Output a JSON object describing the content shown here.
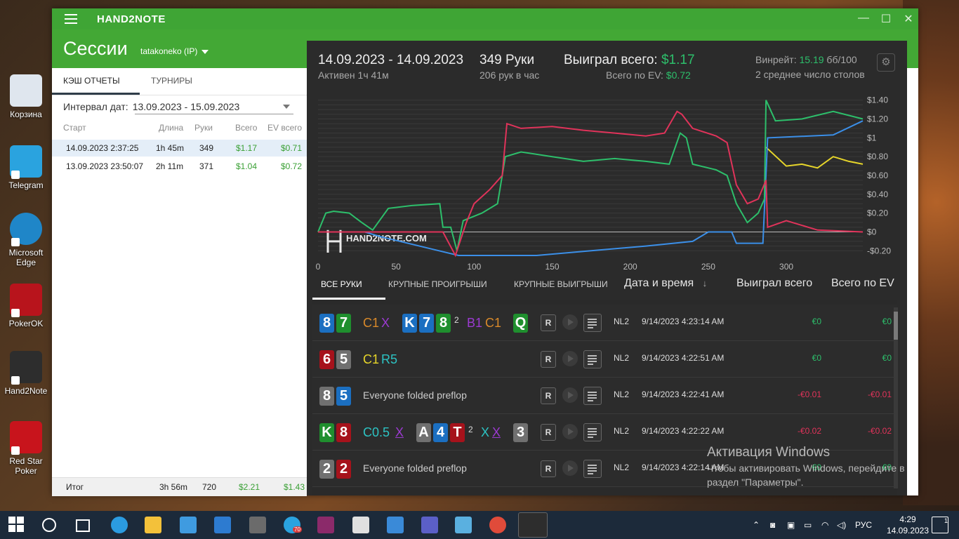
{
  "desktop_icons": [
    {
      "label": "Корзина",
      "icon": "recycle-bin-icon",
      "color": "#dfe6ee"
    },
    {
      "label": "Telegram",
      "icon": "telegram-icon",
      "color": "#2aa3df"
    },
    {
      "label": "Microsoft Edge",
      "icon": "edge-icon",
      "color": "#1f86c8"
    },
    {
      "label": "PokerOK",
      "icon": "pokerok-icon",
      "color": "#b8141c"
    },
    {
      "label": "Hand2Note",
      "icon": "hand2note-icon",
      "color": "#2d2d2d"
    },
    {
      "label": "Red Star Poker",
      "icon": "redstar-poker-icon",
      "color": "#c8141c"
    }
  ],
  "window": {
    "app_name": "HAND2NOTE",
    "controls": {
      "minimize": "—",
      "maximize": "☐",
      "close": "✕"
    }
  },
  "header": {
    "title": "Сессии",
    "user": "tatakoneko (IP)"
  },
  "left": {
    "tabs": [
      "КЭШ ОТЧЕТЫ",
      "ТУРНИРЫ"
    ],
    "interval_label": "Интервал дат:",
    "interval_value": "13.09.2023 - 15.09.2023",
    "columns": [
      "Старт",
      "Длина",
      "Руки",
      "Всего",
      "EV всего"
    ],
    "rows": [
      {
        "start": "14.09.2023 2:37:25",
        "length": "1h 45m",
        "hands": "349",
        "total": "$1.17",
        "ev": "$0.71"
      },
      {
        "start": "13.09.2023 23:50:07",
        "length": "2h 11m",
        "hands": "371",
        "total": "$1.04",
        "ev": "$0.72"
      }
    ],
    "footer": {
      "label": "Итог",
      "length": "3h 56m",
      "hands": "720",
      "total": "$2.21",
      "ev": "$1.43"
    }
  },
  "summary": {
    "date_range": "14.09.2023 - 14.09.2023",
    "active": "Активен 1ч 41м",
    "hands": "349 Руки",
    "hands_per_hour": "206 рук в час",
    "won_label": "Выиграл всего:",
    "won_value": "$1.17",
    "ev_label": "Всего по EV:",
    "ev_value": "$0.72",
    "winrate_label": "Винрейт:",
    "winrate_value": "15.19",
    "winrate_unit": "бб/100",
    "tables": "2 среднее число столов"
  },
  "chart_data": {
    "type": "line",
    "watermark": "HAND2NOTE.COM",
    "x_ticks": [
      0,
      50,
      100,
      150,
      200,
      250,
      300
    ],
    "y_ticks": [
      "$1.40",
      "$1.20",
      "$1",
      "$0.80",
      "$0.60",
      "$0.40",
      "$0.20",
      "$0",
      "-$0.20"
    ],
    "xlim": [
      0,
      349
    ],
    "ylim": [
      -0.25,
      1.45
    ],
    "series": [
      {
        "color": "#e0335a",
        "points": [
          [
            0,
            0
          ],
          [
            20,
            0
          ],
          [
            40,
            0
          ],
          [
            60,
            0
          ],
          [
            80,
            0
          ],
          [
            88,
            -0.25
          ],
          [
            95,
            0.1
          ],
          [
            100,
            0.3
          ],
          [
            110,
            0.45
          ],
          [
            118,
            0.6
          ],
          [
            121,
            1.15
          ],
          [
            130,
            1.1
          ],
          [
            150,
            1.12
          ],
          [
            170,
            1.08
          ],
          [
            190,
            1.05
          ],
          [
            210,
            1.02
          ],
          [
            222,
            1.05
          ],
          [
            230,
            1.28
          ],
          [
            233,
            1.25
          ],
          [
            240,
            1.1
          ],
          [
            255,
            1.02
          ],
          [
            262,
            0.95
          ],
          [
            268,
            0.5
          ],
          [
            275,
            0.3
          ],
          [
            282,
            0.35
          ],
          [
            287,
            0.55
          ],
          [
            288,
            0.05
          ],
          [
            300,
            0.12
          ],
          [
            320,
            0.02
          ],
          [
            349,
            0
          ]
        ]
      },
      {
        "color": "#2dbf6b",
        "points": [
          [
            0,
            0
          ],
          [
            5,
            0.2
          ],
          [
            10,
            0.22
          ],
          [
            20,
            0.2
          ],
          [
            28,
            0.1
          ],
          [
            35,
            0.02
          ],
          [
            45,
            0.25
          ],
          [
            60,
            0.28
          ],
          [
            78,
            0.3
          ],
          [
            80,
            0.05
          ],
          [
            85,
            0.05
          ],
          [
            89,
            -0.2
          ],
          [
            93,
            0.12
          ],
          [
            105,
            0.2
          ],
          [
            115,
            0.3
          ],
          [
            120,
            0.8
          ],
          [
            130,
            0.85
          ],
          [
            150,
            0.8
          ],
          [
            170,
            0.75
          ],
          [
            190,
            0.78
          ],
          [
            210,
            0.75
          ],
          [
            225,
            0.72
          ],
          [
            232,
            1.05
          ],
          [
            236,
            1.0
          ],
          [
            240,
            0.72
          ],
          [
            255,
            0.66
          ],
          [
            262,
            0.6
          ],
          [
            268,
            0.3
          ],
          [
            275,
            0.1
          ],
          [
            282,
            0.2
          ],
          [
            286,
            0.35
          ],
          [
            287,
            1.4
          ],
          [
            293,
            1.18
          ],
          [
            310,
            1.2
          ],
          [
            330,
            1.28
          ],
          [
            349,
            1.2
          ]
        ]
      },
      {
        "color": "#3b8fe8",
        "points": [
          [
            0,
            0
          ],
          [
            30,
            0
          ],
          [
            40,
            -0.05
          ],
          [
            90,
            -0.25
          ],
          [
            140,
            -0.25
          ],
          [
            175,
            -0.2
          ],
          [
            210,
            -0.15
          ],
          [
            240,
            -0.1
          ],
          [
            250,
            0
          ],
          [
            265,
            0
          ],
          [
            268,
            -0.12
          ],
          [
            285,
            -0.12
          ],
          [
            288,
            1.0
          ],
          [
            330,
            1.03
          ],
          [
            349,
            1.18
          ]
        ]
      },
      {
        "color": "#e6d52a",
        "points": [
          [
            287,
            0.9
          ],
          [
            300,
            0.7
          ],
          [
            310,
            0.72
          ],
          [
            320,
            0.68
          ],
          [
            330,
            0.8
          ],
          [
            340,
            0.75
          ],
          [
            349,
            0.72
          ]
        ]
      },
      {
        "color": "#bbbbbb",
        "points": [
          [
            0,
            0
          ],
          [
            349,
            0
          ]
        ]
      }
    ]
  },
  "hand_tabs": {
    "tabs": [
      "ВСЕ РУКИ",
      "КРУПНЫЕ ПРОИГРЫШИ",
      "КРУПНЫЕ ВЫИГРЫШИ"
    ],
    "columns": [
      "Дата и время",
      "Выиграл всего",
      "Всего по EV"
    ],
    "sort_arrow": "↓"
  },
  "hands": [
    {
      "cards": [
        {
          "r": "8",
          "c": "b"
        },
        {
          "r": "7",
          "c": "g"
        }
      ],
      "actions": [
        {
          "t": "C1",
          "col": "#d8892a"
        },
        {
          "t": "X",
          "col": "#9b3ad0"
        }
      ],
      "board": [
        {
          "r": "K",
          "c": "b"
        },
        {
          "r": "7",
          "c": "b"
        },
        {
          "r": "8",
          "c": "g"
        }
      ],
      "sup": "2",
      "actions2": [
        {
          "t": "B1",
          "col": "#9b3ad0"
        },
        {
          "t": "C1",
          "col": "#d8892a"
        }
      ],
      "turn": [
        {
          "r": "Q",
          "c": "g"
        }
      ],
      "limit": "NL2",
      "time": "9/14/2023 4:23:14 AM",
      "won": "€0",
      "ev": "€0",
      "won_pos": true
    },
    {
      "cards": [
        {
          "r": "6",
          "c": "r"
        },
        {
          "r": "5",
          "c": "gr"
        }
      ],
      "actions": [
        {
          "t": "C1",
          "col": "#e6d52a"
        },
        {
          "t": "R5",
          "col": "#2cc3c3"
        }
      ],
      "board": [],
      "sup": "",
      "actions2": [],
      "turn": [],
      "limit": "NL2",
      "time": "9/14/2023 4:22:51 AM",
      "won": "€0",
      "ev": "€0",
      "won_pos": true
    },
    {
      "cards": [
        {
          "r": "8",
          "c": "gr"
        },
        {
          "r": "5",
          "c": "b"
        }
      ],
      "text": "Everyone folded preflop",
      "limit": "NL2",
      "time": "9/14/2023 4:22:41 AM",
      "won": "-€0.01",
      "ev": "-€0.01",
      "won_pos": false
    },
    {
      "cards": [
        {
          "r": "K",
          "c": "g"
        },
        {
          "r": "8",
          "c": "r"
        }
      ],
      "actions": [
        {
          "t": "C0.5",
          "col": "#2cc3c3"
        },
        {
          "t": "X",
          "col": "#9b3ad0"
        }
      ],
      "board": [
        {
          "r": "A",
          "c": "gr"
        },
        {
          "r": "4",
          "c": "b"
        },
        {
          "r": "T",
          "c": "r"
        }
      ],
      "sup": "2",
      "actions2": [
        {
          "t": "X",
          "col": "#2cc3c3"
        },
        {
          "t": "X",
          "col": "#9b3ad0"
        }
      ],
      "turn": [
        {
          "r": "3",
          "c": "gr"
        }
      ],
      "limit": "NL2",
      "time": "9/14/2023 4:22:22 AM",
      "won": "-€0.02",
      "ev": "-€0.02",
      "won_pos": false
    },
    {
      "cards": [
        {
          "r": "2",
          "c": "gr"
        },
        {
          "r": "2",
          "c": "r"
        }
      ],
      "text": "Everyone folded preflop",
      "limit": "NL2",
      "time": "9/14/2023 4:22:14 AM",
      "won": "€0",
      "ev": "€0",
      "won_pos": true
    }
  ],
  "watermark": {
    "title": "Активация Windows",
    "text": "Чтобы активировать Windows, перейдите в раздел \"Параметры\"."
  },
  "taskbar": {
    "apps": [
      "start-icon",
      "search-icon",
      "task-view-icon",
      "edge-icon",
      "explorer-icon",
      "store-icon",
      "mail-icon",
      "calculator-icon",
      "telegram-icon",
      "winrar-icon",
      "wordpad-icon",
      "remote-icon",
      "teams-icon",
      "notes-icon",
      "chrome-icon",
      "hand2note-icon"
    ],
    "telegram_badge": "70",
    "lang": "РУС",
    "time": "4:29",
    "date": "14.09.2023",
    "notify_count": "1"
  }
}
